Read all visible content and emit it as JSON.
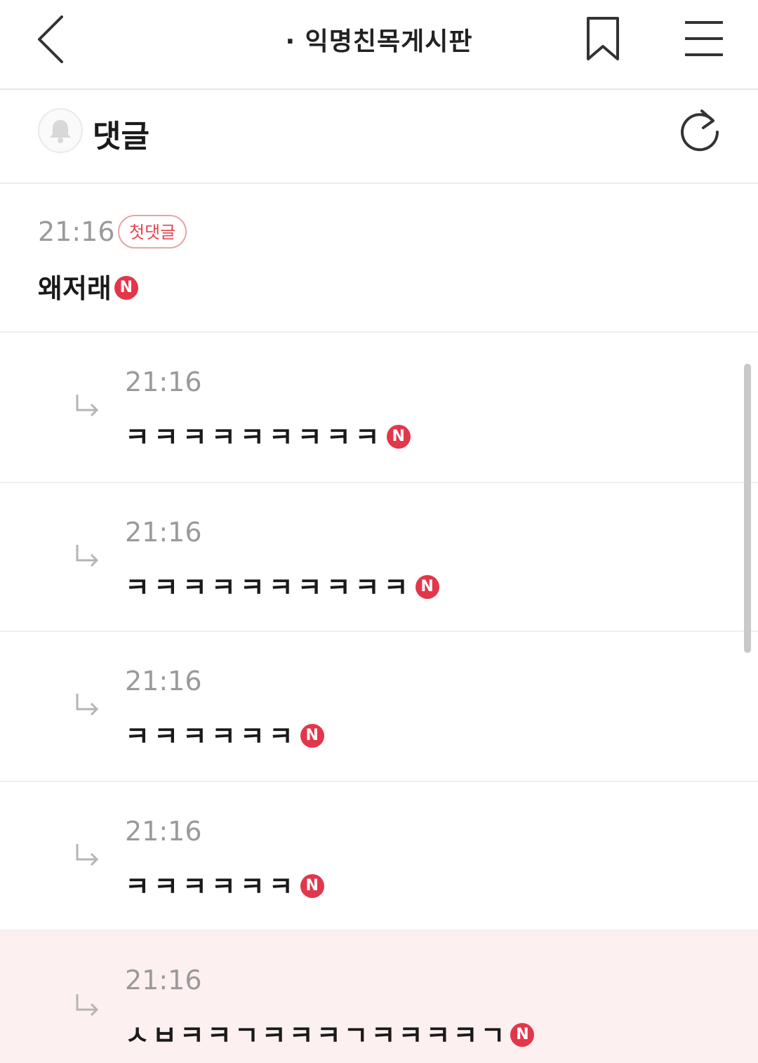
{
  "header": {
    "title": "· 익명친목게시판",
    "back_icon": "chevron-left-icon",
    "bookmark_icon": "bookmark-icon",
    "menu_icon": "hamburger-menu-icon"
  },
  "comments_section": {
    "title": "댓글",
    "bell_icon": "bell-icon",
    "refresh_icon": "refresh-icon"
  },
  "colors": {
    "accent": "#e2374a",
    "highlight_bg": "#fdf0f0",
    "time_text": "#9a9a9a"
  },
  "comments": [
    {
      "time": "21:16",
      "badge": "첫댓글",
      "text": "왜저래",
      "new_badge": "N",
      "is_reply": false
    },
    {
      "time": "21:16",
      "text": "ㅋㅋㅋㅋㅋㅋㅋㅋㅋ",
      "new_badge": "N",
      "is_reply": true
    },
    {
      "time": "21:16",
      "text": "ㅋㅋㅋㅋㅋㅋㅋㅋㅋㅋ",
      "new_badge": "N",
      "is_reply": true
    },
    {
      "time": "21:16",
      "text": "ㅋㅋㅋㅋㅋㅋ",
      "new_badge": "N",
      "is_reply": true
    },
    {
      "time": "21:16",
      "text": "ㅋㅋㅋㅋㅋㅋ",
      "new_badge": "N",
      "is_reply": true
    },
    {
      "time": "21:16",
      "text": "ㅅㅂㅋㅋㄱㅋㅋㅋㄱㅋㅋㅋㅋㄱ",
      "new_badge": "N",
      "is_reply": true
    }
  ]
}
